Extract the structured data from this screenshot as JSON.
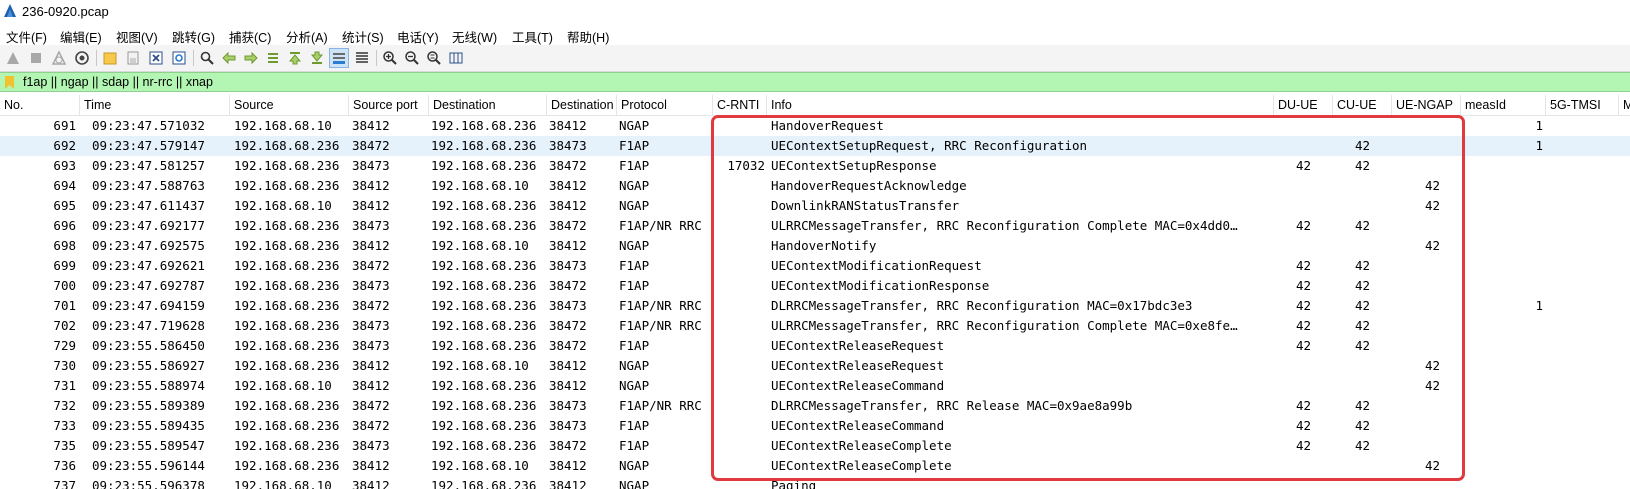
{
  "window": {
    "title": "236-0920.pcap"
  },
  "menu": [
    "文件(F)",
    "编辑(E)",
    "视图(V)",
    "跳转(G)",
    "捕获(C)",
    "分析(A)",
    "统计(S)",
    "电话(Y)",
    "无线(W)",
    "工具(T)",
    "帮助(H)"
  ],
  "toolbar": [
    "start-capture-icon",
    "stop-capture-icon",
    "restart-capture-icon",
    "capture-options-icon",
    "open-file-icon",
    "save-file-icon",
    "close-file-icon",
    "reload-file-icon",
    "find-packet-icon",
    "go-back-icon",
    "go-forward-icon",
    "go-to-packet-icon",
    "go-first-packet-icon",
    "go-last-packet-icon",
    "auto-scroll-icon",
    "colorize-icon",
    "zoom-in-icon",
    "zoom-out-icon",
    "normal-size-icon",
    "resize-columns-icon"
  ],
  "filter": {
    "value": "f1ap || ngap || sdap || nr-rrc || xnap"
  },
  "columns": [
    "No.",
    "Time",
    "Source",
    "Source port",
    "Destination",
    "Destination",
    "Protocol",
    "C-RNTI",
    "Info",
    "DU-UE",
    "CU-UE",
    "UE-NGAP",
    "measId",
    "5G-TMSI",
    "M"
  ],
  "packets": [
    {
      "no": "691",
      "time": "09:23:47.571032",
      "src": "192.168.68.10",
      "sport": "38412",
      "dst": "192.168.68.236",
      "dport": "38412",
      "proto": "NGAP",
      "crnti": "",
      "info": "HandoverRequest",
      "du": "",
      "cu": "",
      "ngap": "",
      "meas": "1",
      "tmsi": ""
    },
    {
      "no": "692",
      "time": "09:23:47.579147",
      "src": "192.168.68.236",
      "sport": "38472",
      "dst": "192.168.68.236",
      "dport": "38473",
      "proto": "F1AP",
      "crnti": "",
      "info": "UEContextSetupRequest, RRC Reconfiguration",
      "du": "",
      "cu": "42",
      "ngap": "",
      "meas": "1",
      "tmsi": ""
    },
    {
      "no": "693",
      "time": "09:23:47.581257",
      "src": "192.168.68.236",
      "sport": "38473",
      "dst": "192.168.68.236",
      "dport": "38472",
      "proto": "F1AP",
      "crnti": "17032",
      "info": "UEContextSetupResponse",
      "du": "42",
      "cu": "42",
      "ngap": "",
      "meas": "",
      "tmsi": ""
    },
    {
      "no": "694",
      "time": "09:23:47.588763",
      "src": "192.168.68.236",
      "sport": "38412",
      "dst": "192.168.68.10",
      "dport": "38412",
      "proto": "NGAP",
      "crnti": "",
      "info": "HandoverRequestAcknowledge",
      "du": "",
      "cu": "",
      "ngap": "42",
      "meas": "",
      "tmsi": ""
    },
    {
      "no": "695",
      "time": "09:23:47.611437",
      "src": "192.168.68.10",
      "sport": "38412",
      "dst": "192.168.68.236",
      "dport": "38412",
      "proto": "NGAP",
      "crnti": "",
      "info": "DownlinkRANStatusTransfer",
      "du": "",
      "cu": "",
      "ngap": "42",
      "meas": "",
      "tmsi": ""
    },
    {
      "no": "696",
      "time": "09:23:47.692177",
      "src": "192.168.68.236",
      "sport": "38473",
      "dst": "192.168.68.236",
      "dport": "38472",
      "proto": "F1AP/NR RRC",
      "crnti": "",
      "info": "ULRRCMessageTransfer, RRC Reconfiguration Complete MAC=0x4dd0…",
      "du": "42",
      "cu": "42",
      "ngap": "",
      "meas": "",
      "tmsi": ""
    },
    {
      "no": "698",
      "time": "09:23:47.692575",
      "src": "192.168.68.236",
      "sport": "38412",
      "dst": "192.168.68.10",
      "dport": "38412",
      "proto": "NGAP",
      "crnti": "",
      "info": "HandoverNotify",
      "du": "",
      "cu": "",
      "ngap": "42",
      "meas": "",
      "tmsi": ""
    },
    {
      "no": "699",
      "time": "09:23:47.692621",
      "src": "192.168.68.236",
      "sport": "38472",
      "dst": "192.168.68.236",
      "dport": "38473",
      "proto": "F1AP",
      "crnti": "",
      "info": "UEContextModificationRequest",
      "du": "42",
      "cu": "42",
      "ngap": "",
      "meas": "",
      "tmsi": ""
    },
    {
      "no": "700",
      "time": "09:23:47.692787",
      "src": "192.168.68.236",
      "sport": "38473",
      "dst": "192.168.68.236",
      "dport": "38472",
      "proto": "F1AP",
      "crnti": "",
      "info": "UEContextModificationResponse",
      "du": "42",
      "cu": "42",
      "ngap": "",
      "meas": "",
      "tmsi": ""
    },
    {
      "no": "701",
      "time": "09:23:47.694159",
      "src": "192.168.68.236",
      "sport": "38472",
      "dst": "192.168.68.236",
      "dport": "38473",
      "proto": "F1AP/NR RRC",
      "crnti": "",
      "info": "DLRRCMessageTransfer, RRC Reconfiguration MAC=0x17bdc3e3",
      "du": "42",
      "cu": "42",
      "ngap": "",
      "meas": "1",
      "tmsi": ""
    },
    {
      "no": "702",
      "time": "09:23:47.719628",
      "src": "192.168.68.236",
      "sport": "38473",
      "dst": "192.168.68.236",
      "dport": "38472",
      "proto": "F1AP/NR RRC",
      "crnti": "",
      "info": "ULRRCMessageTransfer, RRC Reconfiguration Complete MAC=0xe8fe…",
      "du": "42",
      "cu": "42",
      "ngap": "",
      "meas": "",
      "tmsi": ""
    },
    {
      "no": "729",
      "time": "09:23:55.586450",
      "src": "192.168.68.236",
      "sport": "38473",
      "dst": "192.168.68.236",
      "dport": "38472",
      "proto": "F1AP",
      "crnti": "",
      "info": "UEContextReleaseRequest",
      "du": "42",
      "cu": "42",
      "ngap": "",
      "meas": "",
      "tmsi": ""
    },
    {
      "no": "730",
      "time": "09:23:55.586927",
      "src": "192.168.68.236",
      "sport": "38412",
      "dst": "192.168.68.10",
      "dport": "38412",
      "proto": "NGAP",
      "crnti": "",
      "info": "UEContextReleaseRequest",
      "du": "",
      "cu": "",
      "ngap": "42",
      "meas": "",
      "tmsi": ""
    },
    {
      "no": "731",
      "time": "09:23:55.588974",
      "src": "192.168.68.10",
      "sport": "38412",
      "dst": "192.168.68.236",
      "dport": "38412",
      "proto": "NGAP",
      "crnti": "",
      "info": "UEContextReleaseCommand",
      "du": "",
      "cu": "",
      "ngap": "42",
      "meas": "",
      "tmsi": ""
    },
    {
      "no": "732",
      "time": "09:23:55.589389",
      "src": "192.168.68.236",
      "sport": "38472",
      "dst": "192.168.68.236",
      "dport": "38473",
      "proto": "F1AP/NR RRC",
      "crnti": "",
      "info": "DLRRCMessageTransfer, RRC Release MAC=0x9ae8a99b",
      "du": "42",
      "cu": "42",
      "ngap": "",
      "meas": "",
      "tmsi": ""
    },
    {
      "no": "733",
      "time": "09:23:55.589435",
      "src": "192.168.68.236",
      "sport": "38472",
      "dst": "192.168.68.236",
      "dport": "38473",
      "proto": "F1AP",
      "crnti": "",
      "info": "UEContextReleaseCommand",
      "du": "42",
      "cu": "42",
      "ngap": "",
      "meas": "",
      "tmsi": ""
    },
    {
      "no": "735",
      "time": "09:23:55.589547",
      "src": "192.168.68.236",
      "sport": "38473",
      "dst": "192.168.68.236",
      "dport": "38472",
      "proto": "F1AP",
      "crnti": "",
      "info": "UEContextReleaseComplete",
      "du": "42",
      "cu": "42",
      "ngap": "",
      "meas": "",
      "tmsi": ""
    },
    {
      "no": "736",
      "time": "09:23:55.596144",
      "src": "192.168.68.236",
      "sport": "38412",
      "dst": "192.168.68.10",
      "dport": "38412",
      "proto": "NGAP",
      "crnti": "",
      "info": "UEContextReleaseComplete",
      "du": "",
      "cu": "",
      "ngap": "42",
      "meas": "",
      "tmsi": ""
    },
    {
      "no": "737",
      "time": "09:23:55.596378",
      "src": "192.168.68.10",
      "sport": "38412",
      "dst": "192.168.68.236",
      "dport": "38412",
      "proto": "NGAP",
      "crnti": "",
      "info": "Paging",
      "du": "",
      "cu": "",
      "ngap": "",
      "meas": "",
      "tmsi": ""
    }
  ],
  "selected_packet": "692",
  "colors": {
    "filter_bg": "#b3f5b3",
    "selected_row": "#e5f1fb",
    "highlight_box": "#e03a3e"
  }
}
